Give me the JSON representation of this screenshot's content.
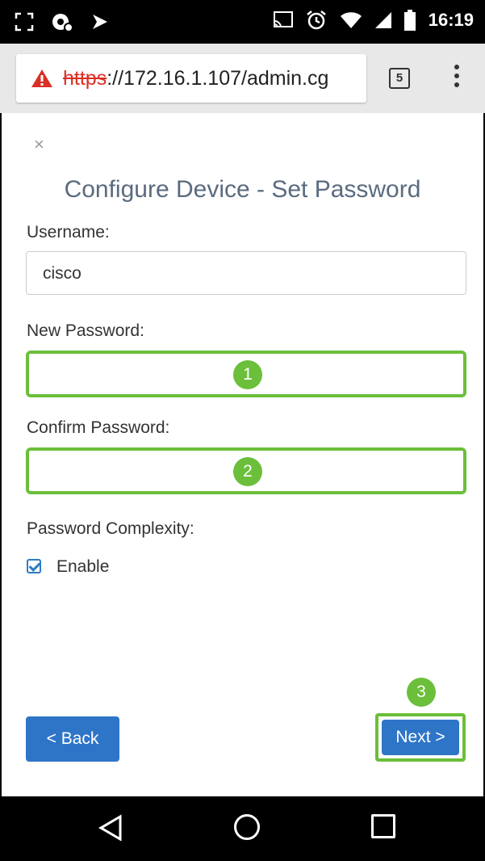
{
  "status_bar": {
    "time": "16:19",
    "icons": [
      "screenshot-icon",
      "sync-icon",
      "signal-icon",
      "cast-icon",
      "alarm-icon",
      "wifi-icon",
      "cell-signal-icon",
      "battery-icon"
    ]
  },
  "browser": {
    "url_scheme": "https",
    "url_rest": "://172.16.1.107/admin.cg",
    "tab_count": "5"
  },
  "dialog": {
    "close": "×",
    "title": "Configure Device - Set Password",
    "username_label": "Username:",
    "username_value": "cisco",
    "new_password_label": "New Password:",
    "confirm_password_label": "Confirm Password:",
    "complexity_label": "Password Complexity:",
    "enable_label": "Enable",
    "enable_checked": true
  },
  "annotations": {
    "step1": "1",
    "step2": "2",
    "step3": "3",
    "color": "#6bbf3a"
  },
  "buttons": {
    "back_label": "< Back",
    "next_label": "Next >",
    "primary_color": "#2e75c8"
  }
}
